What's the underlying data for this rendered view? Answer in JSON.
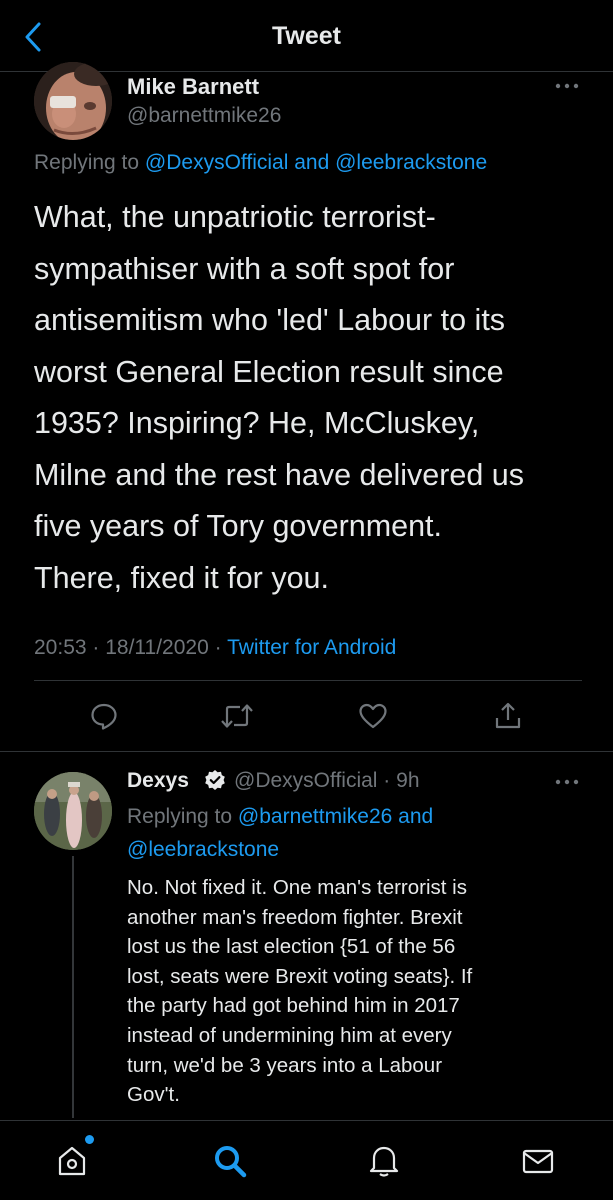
{
  "header": {
    "title": "Tweet",
    "back_icon": "chevron-left-icon"
  },
  "main_tweet": {
    "author_name": "Mike Barnett",
    "author_handle": "@barnettmike26",
    "replying_prefix": "Replying to ",
    "replying_user1": "@DexysOfficial",
    "replying_and": " and ",
    "replying_user2": "@leebrackstone",
    "body_lines": [
      "What, the unpatriotic terrorist-",
      "sympathiser with a soft spot for",
      "antisemitism who 'led' Labour to its",
      "worst General Election result since",
      "1935? Inspiring? He, McCluskey,",
      "Milne and the rest have delivered us",
      "five years of Tory government.",
      "There, fixed it for you."
    ],
    "time": "20:53",
    "separator": " · ",
    "date": "18/11/2020",
    "source": "Twitter for Android",
    "actions": [
      "reply-icon",
      "retweet-icon",
      "like-icon",
      "share-icon"
    ]
  },
  "reply_tweet": {
    "author_name": "Dexys",
    "verified_icon": "verified-badge-icon",
    "author_handle": "@DexysOfficial",
    "time_sep": " · ",
    "time_ago": "9h",
    "replying_prefix": "Replying to ",
    "replying_user1": "@barnettmike26",
    "replying_and": " and",
    "replying_user2": "@leebrackstone",
    "body_lines": [
      "No. Not fixed it.  One man's terrorist is",
      "another man's freedom fighter. Brexit",
      "lost us the last election {51 of the 56",
      "lost, seats were Brexit voting seats}.  If",
      "the party had got behind him in 2017",
      "instead of undermining him at every",
      "turn, we'd be 3 years into a Labour",
      "Gov't."
    ]
  },
  "tabbar": {
    "tabs": [
      "home-icon",
      "search-icon",
      "notifications-icon",
      "messages-icon"
    ],
    "active_tab": "search-icon"
  },
  "colors": {
    "background": "#000000",
    "text": "#e7e9ea",
    "secondary_text": "#71767b",
    "accent": "#1d9bf0",
    "divider": "#2f3336"
  }
}
